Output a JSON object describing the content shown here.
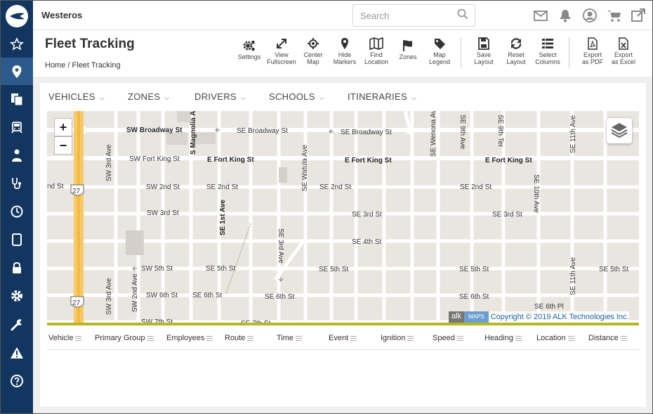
{
  "app": {
    "org_name": "Westeros",
    "search_placeholder": "Search"
  },
  "sidebar": {
    "items": [
      "favorites-icon",
      "map-marker-icon",
      "reports-icon",
      "bus-icon",
      "driver-icon",
      "stethoscope-icon",
      "clock-icon",
      "tablet-icon",
      "lock-icon",
      "gear-icon",
      "wrench-icon",
      "warning-icon",
      "help-icon"
    ],
    "active": "map-marker-icon"
  },
  "topbar": {
    "icons": [
      "mail-icon",
      "bell-icon",
      "user-icon",
      "cart-icon",
      "external-link-icon"
    ]
  },
  "page": {
    "title": "Fleet Tracking",
    "breadcrumb_home": "Home",
    "breadcrumb_sep": "/",
    "breadcrumb_current": "Fleet Tracking"
  },
  "toolbar": {
    "settings": "Settings",
    "fullscreen_1": "View",
    "fullscreen_2": "Fullscreen",
    "center_1": "Center",
    "center_2": "Map",
    "hide_1": "Hide",
    "hide_2": "Markers",
    "find_1": "Find",
    "find_2": "Location",
    "zones": "Zones",
    "legend_1": "Map",
    "legend_2": "Legend",
    "save_1": "Save",
    "save_2": "Layout",
    "reset_1": "Reset",
    "reset_2": "Layout",
    "select_1": "Select",
    "select_2": "Columns",
    "pdf_1": "Export",
    "pdf_2": "as PDF",
    "excel_1": "Export",
    "excel_2": "as Excel"
  },
  "filters": {
    "vehicles": "VEHICLES",
    "zones": "ZONES",
    "drivers": "DRIVERS",
    "schools": "SCHOOLS",
    "itineraries": "ITINERARIES"
  },
  "map": {
    "zoom_in": "+",
    "zoom_out": "−",
    "attribution_alk": "alk",
    "attribution_maps": "MAPS",
    "attribution_text": "Copyright © 2019 ALK Technologies Inc.",
    "labels": {
      "sw_broadway": "SW Broadway St",
      "se_broadway_1": "SE Broadway St",
      "se_broadway_2": "SE Broadway St",
      "sw_fort_king": "SW Fort King St",
      "e_fort_king_1": "E Fort King St",
      "e_fort_king_2": "E Fort King St",
      "e_fort_king_3": "E Fort King St",
      "nd_st": "nd St",
      "sw_2nd": "SW 2nd St",
      "se_2nd_1": "SE 2nd St",
      "se_2nd_2": "SE 2nd St",
      "se_2nd_3": "SE 2nd St",
      "sw_3rd": "SW 3rd St",
      "se_3rd_1": "SE 3rd St",
      "se_3rd_2": "SE 3rd St",
      "se_4th": "SE 4th St",
      "sw_5th": "SW 5th St",
      "se_5th_1": "SE 5th St",
      "se_5th_2": "SE 5th St",
      "se_5th_3": "SE 5th St",
      "se_5th_4": "SE 5th St",
      "sw_6th": "SW 6th St",
      "se_6th_1": "SE 6th St",
      "se_6th_2": "SE 6th St",
      "se_6th_3": "SE 6th St",
      "se_6th_pl": "SE 6th Pl",
      "sw_7th": "SW 7th St",
      "se_7th": "SE 7th St",
      "sw_3rd_ave_1": "SW 3rd Ave",
      "sw_3rd_ave_2": "SW 3rd Ave",
      "sw_2nd_ave": "SW 2nd Ave",
      "s_magnolia": "S Magnolia Ave",
      "se_1st_ave": "SE 1st Ave",
      "se_watula": "SE Watula Ave",
      "se_3rd_ave": "SE 3rd Ave",
      "se_wenona": "SE Wenona Ave",
      "se_9th_ave": "SE 9th Ave",
      "se_9th_ter": "SE 9th Ter",
      "se_10th_ave": "SE 10th Ave",
      "se_11th_ave_1": "SE 11th Ave",
      "se_11th_ave_2": "SE 11th Ave",
      "shield_1": "27",
      "shield_2": "27"
    }
  },
  "table": {
    "columns": [
      "Vehicle",
      "Primary Group",
      "Employees",
      "Route",
      "Time",
      "Event",
      "Ignition",
      "Speed",
      "Heading",
      "Location",
      "Distance"
    ]
  }
}
